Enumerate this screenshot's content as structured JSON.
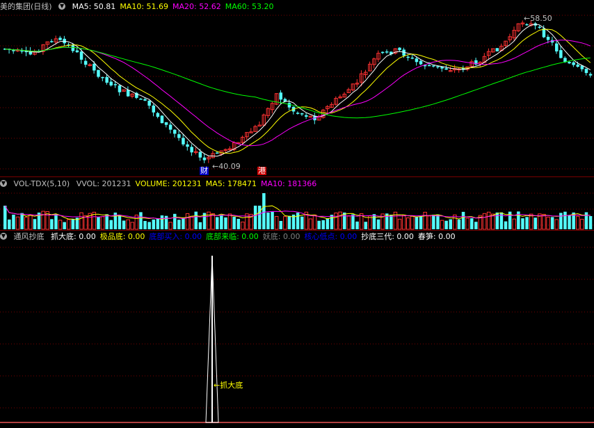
{
  "main_panel": {
    "title": "美的集团(日线)",
    "ma": [
      {
        "label": "MA5: 50.81",
        "color": "#ffffff"
      },
      {
        "label": "MA10: 51.69",
        "color": "#ffff00"
      },
      {
        "label": "MA20: 52.62",
        "color": "#ff00ff"
      },
      {
        "label": "MA60: 53.20",
        "color": "#00ff00"
      }
    ],
    "high_label": "58.50",
    "low_label": "40.09",
    "marker_cai": "财",
    "marker_gang": "港"
  },
  "volume_panel": {
    "title": "VOL-TDX(5,10)",
    "items": [
      {
        "label": "VVOL: 201231",
        "color": "#c0c0c0"
      },
      {
        "label": "VOLUME: 201231",
        "color": "#ffff00"
      },
      {
        "label": "MA5: 178471",
        "color": "#ffff00"
      },
      {
        "label": "MA10: 181366",
        "color": "#ff00ff"
      }
    ]
  },
  "indicator_panel": {
    "title": "通风抄底",
    "items": [
      {
        "label": "抓大底: 0.00",
        "color": "#ffffff"
      },
      {
        "label": "极品底: 0.00",
        "color": "#ffff00"
      },
      {
        "label": "底部买入: 0.00",
        "color": "#0000ff"
      },
      {
        "label": "底部来临: 0.00",
        "color": "#00ff00"
      },
      {
        "label": "妖底: 0.00",
        "color": "#808080"
      },
      {
        "label": "核心低点: 0.00",
        "color": "#0000ff"
      },
      {
        "label": "抄底三代: 0.00",
        "color": "#ffffff"
      },
      {
        "label": "春笋: 0.00",
        "color": "#ffffff"
      }
    ],
    "signal_label": "抓大底"
  }
}
